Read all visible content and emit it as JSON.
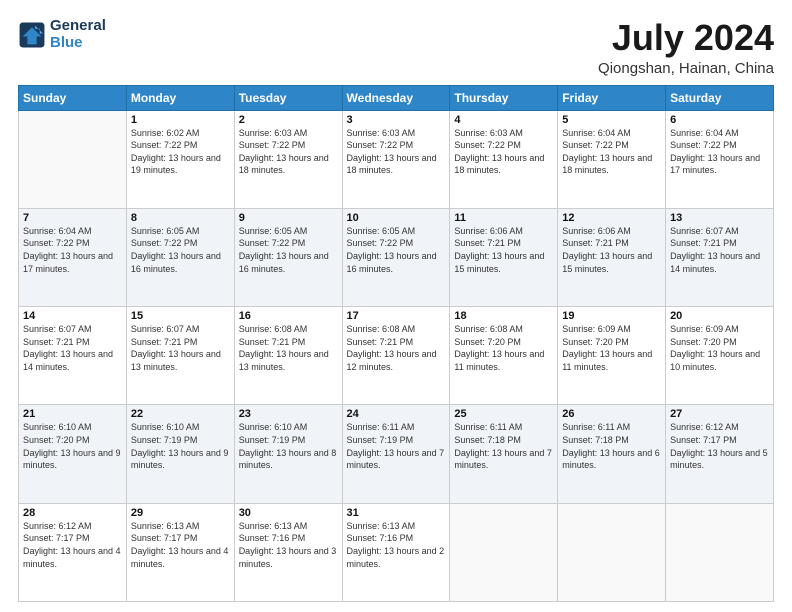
{
  "logo": {
    "line1": "General",
    "line2": "Blue"
  },
  "title": "July 2024",
  "subtitle": "Qiongshan, Hainan, China",
  "weekdays": [
    "Sunday",
    "Monday",
    "Tuesday",
    "Wednesday",
    "Thursday",
    "Friday",
    "Saturday"
  ],
  "weeks": [
    [
      {
        "day": "",
        "empty": true
      },
      {
        "day": "1",
        "sunrise": "6:02 AM",
        "sunset": "7:22 PM",
        "daylight": "13 hours and 19 minutes."
      },
      {
        "day": "2",
        "sunrise": "6:03 AM",
        "sunset": "7:22 PM",
        "daylight": "13 hours and 18 minutes."
      },
      {
        "day": "3",
        "sunrise": "6:03 AM",
        "sunset": "7:22 PM",
        "daylight": "13 hours and 18 minutes."
      },
      {
        "day": "4",
        "sunrise": "6:03 AM",
        "sunset": "7:22 PM",
        "daylight": "13 hours and 18 minutes."
      },
      {
        "day": "5",
        "sunrise": "6:04 AM",
        "sunset": "7:22 PM",
        "daylight": "13 hours and 18 minutes."
      },
      {
        "day": "6",
        "sunrise": "6:04 AM",
        "sunset": "7:22 PM",
        "daylight": "13 hours and 17 minutes."
      }
    ],
    [
      {
        "day": "7",
        "sunrise": "6:04 AM",
        "sunset": "7:22 PM",
        "daylight": "13 hours and 17 minutes."
      },
      {
        "day": "8",
        "sunrise": "6:05 AM",
        "sunset": "7:22 PM",
        "daylight": "13 hours and 16 minutes."
      },
      {
        "day": "9",
        "sunrise": "6:05 AM",
        "sunset": "7:22 PM",
        "daylight": "13 hours and 16 minutes."
      },
      {
        "day": "10",
        "sunrise": "6:05 AM",
        "sunset": "7:22 PM",
        "daylight": "13 hours and 16 minutes."
      },
      {
        "day": "11",
        "sunrise": "6:06 AM",
        "sunset": "7:21 PM",
        "daylight": "13 hours and 15 minutes."
      },
      {
        "day": "12",
        "sunrise": "6:06 AM",
        "sunset": "7:21 PM",
        "daylight": "13 hours and 15 minutes."
      },
      {
        "day": "13",
        "sunrise": "6:07 AM",
        "sunset": "7:21 PM",
        "daylight": "13 hours and 14 minutes."
      }
    ],
    [
      {
        "day": "14",
        "sunrise": "6:07 AM",
        "sunset": "7:21 PM",
        "daylight": "13 hours and 14 minutes."
      },
      {
        "day": "15",
        "sunrise": "6:07 AM",
        "sunset": "7:21 PM",
        "daylight": "13 hours and 13 minutes."
      },
      {
        "day": "16",
        "sunrise": "6:08 AM",
        "sunset": "7:21 PM",
        "daylight": "13 hours and 13 minutes."
      },
      {
        "day": "17",
        "sunrise": "6:08 AM",
        "sunset": "7:21 PM",
        "daylight": "13 hours and 12 minutes."
      },
      {
        "day": "18",
        "sunrise": "6:08 AM",
        "sunset": "7:20 PM",
        "daylight": "13 hours and 11 minutes."
      },
      {
        "day": "19",
        "sunrise": "6:09 AM",
        "sunset": "7:20 PM",
        "daylight": "13 hours and 11 minutes."
      },
      {
        "day": "20",
        "sunrise": "6:09 AM",
        "sunset": "7:20 PM",
        "daylight": "13 hours and 10 minutes."
      }
    ],
    [
      {
        "day": "21",
        "sunrise": "6:10 AM",
        "sunset": "7:20 PM",
        "daylight": "13 hours and 9 minutes."
      },
      {
        "day": "22",
        "sunrise": "6:10 AM",
        "sunset": "7:19 PM",
        "daylight": "13 hours and 9 minutes."
      },
      {
        "day": "23",
        "sunrise": "6:10 AM",
        "sunset": "7:19 PM",
        "daylight": "13 hours and 8 minutes."
      },
      {
        "day": "24",
        "sunrise": "6:11 AM",
        "sunset": "7:19 PM",
        "daylight": "13 hours and 7 minutes."
      },
      {
        "day": "25",
        "sunrise": "6:11 AM",
        "sunset": "7:18 PM",
        "daylight": "13 hours and 7 minutes."
      },
      {
        "day": "26",
        "sunrise": "6:11 AM",
        "sunset": "7:18 PM",
        "daylight": "13 hours and 6 minutes."
      },
      {
        "day": "27",
        "sunrise": "6:12 AM",
        "sunset": "7:17 PM",
        "daylight": "13 hours and 5 minutes."
      }
    ],
    [
      {
        "day": "28",
        "sunrise": "6:12 AM",
        "sunset": "7:17 PM",
        "daylight": "13 hours and 4 minutes."
      },
      {
        "day": "29",
        "sunrise": "6:13 AM",
        "sunset": "7:17 PM",
        "daylight": "13 hours and 4 minutes."
      },
      {
        "day": "30",
        "sunrise": "6:13 AM",
        "sunset": "7:16 PM",
        "daylight": "13 hours and 3 minutes."
      },
      {
        "day": "31",
        "sunrise": "6:13 AM",
        "sunset": "7:16 PM",
        "daylight": "13 hours and 2 minutes."
      },
      {
        "day": "",
        "empty": true
      },
      {
        "day": "",
        "empty": true
      },
      {
        "day": "",
        "empty": true
      }
    ]
  ]
}
